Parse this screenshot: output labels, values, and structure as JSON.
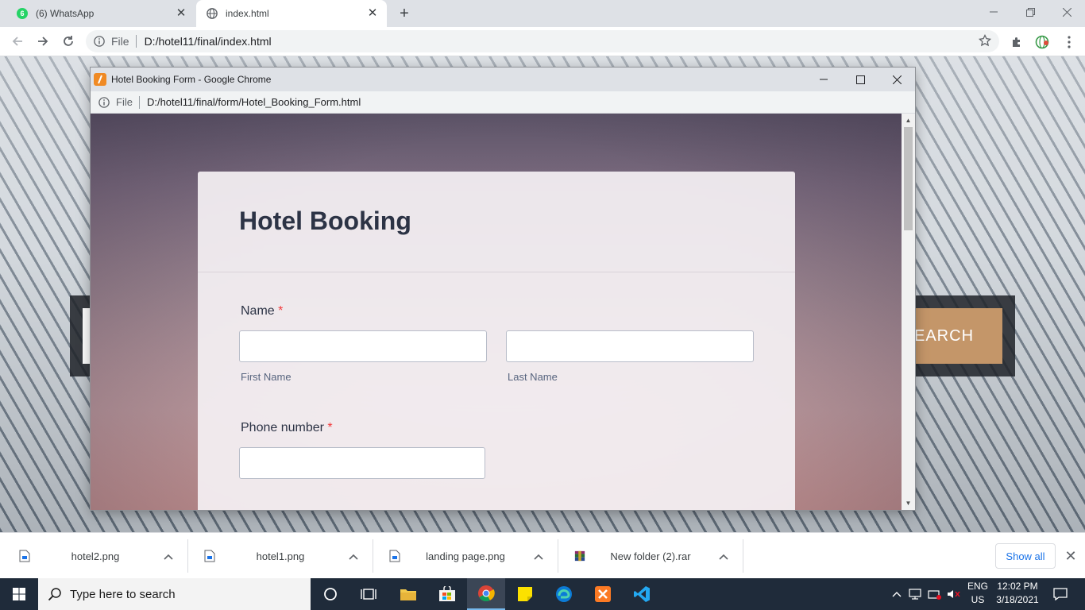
{
  "browser": {
    "tabs": [
      {
        "title": "(6) WhatsApp",
        "badge": "6",
        "active": false
      },
      {
        "title": "index.html",
        "active": true
      }
    ],
    "address": {
      "scheme": "File",
      "url": "D:/hotel11/final/index.html"
    }
  },
  "background_page": {
    "search_button_label": "EARCH"
  },
  "popup": {
    "title": "Hotel Booking Form - Google Chrome",
    "address": {
      "scheme": "File",
      "url": "D:/hotel11/final/form/Hotel_Booking_Form.html"
    },
    "form": {
      "heading": "Hotel Booking",
      "name_label": "Name",
      "required_mark": "*",
      "first_name_sublabel": "First Name",
      "last_name_sublabel": "Last Name",
      "first_name_value": "",
      "last_name_value": "",
      "phone_label": "Phone number",
      "phone_value": ""
    }
  },
  "downloads": {
    "items": [
      {
        "name": "hotel2.png",
        "type": "png"
      },
      {
        "name": "hotel1.png",
        "type": "png"
      },
      {
        "name": "landing page.png",
        "type": "png"
      },
      {
        "name": "New folder (2).rar",
        "type": "rar"
      }
    ],
    "show_all_label": "Show all"
  },
  "taskbar": {
    "search_placeholder": "Type here to search",
    "language_top": "ENG",
    "language_bottom": "US",
    "time": "12:02 PM",
    "date": "3/18/2021"
  },
  "colors": {
    "accent_button": "#c49669",
    "required": "#f23a3c",
    "link": "#1a73e8"
  }
}
